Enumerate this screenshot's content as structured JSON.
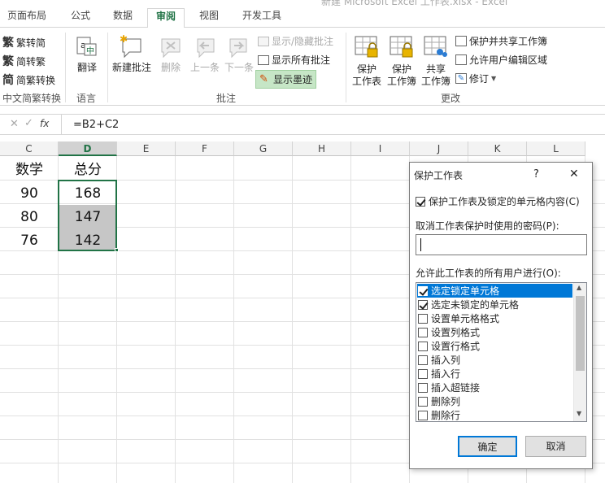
{
  "window_title": "新建 Microsoft Excel 工作表.xlsx - Excel",
  "tabs": [
    {
      "label": "页面布局"
    },
    {
      "label": "公式"
    },
    {
      "label": "数据"
    },
    {
      "label": "审阅",
      "active": true
    },
    {
      "label": "视图"
    },
    {
      "label": "开发工具"
    }
  ],
  "ribbon": {
    "group_chinese": {
      "label": "中文简繁转换",
      "items": [
        "繁转简",
        "简转繁",
        "简繁转换"
      ]
    },
    "group_language": {
      "label": "语言",
      "translate": "翻译"
    },
    "group_comments": {
      "label": "批注",
      "new_comment": "新建批注",
      "delete": "删除",
      "previous": "上一条",
      "next": "下一条",
      "show_hide": "显示/隐藏批注",
      "show_all": "显示所有批注",
      "show_ink": "显示墨迹"
    },
    "group_changes": {
      "label": "更改",
      "protect_sheet_1": "保护",
      "protect_sheet_2": "工作表",
      "protect_workbook_1": "保护",
      "protect_workbook_2": "工作簿",
      "share_workbook_1": "共享",
      "share_workbook_2": "工作簿",
      "protect_share": "保护并共享工作簿",
      "allow_edit": "允许用户编辑区域",
      "track_changes": "修订"
    }
  },
  "formula_bar": {
    "fx": "fx",
    "formula": "=B2+C2"
  },
  "columns": [
    "C",
    "D",
    "E",
    "F",
    "G",
    "H",
    "I",
    "J",
    "K",
    "L"
  ],
  "cells": {
    "c1": "数学",
    "d1": "总分",
    "c2": "90",
    "d2": "168",
    "c3": "80",
    "d3": "147",
    "c4": "76",
    "d4": "142"
  },
  "dialog": {
    "title": "保护工作表",
    "help": "?",
    "close": "✕",
    "protect_checkbox_label": "保护工作表及锁定的单元格内容(C)",
    "protect_checked": true,
    "password_label": "取消工作表保护时使用的密码(P):",
    "password_value": "",
    "allow_label": "允许此工作表的所有用户进行(O):",
    "options": [
      {
        "label": "选定锁定单元格",
        "checked": true,
        "selected": true
      },
      {
        "label": "选定未锁定的单元格",
        "checked": true
      },
      {
        "label": "设置单元格格式",
        "checked": false
      },
      {
        "label": "设置列格式",
        "checked": false
      },
      {
        "label": "设置行格式",
        "checked": false
      },
      {
        "label": "插入列",
        "checked": false
      },
      {
        "label": "插入行",
        "checked": false
      },
      {
        "label": "插入超链接",
        "checked": false
      },
      {
        "label": "删除列",
        "checked": false
      },
      {
        "label": "删除行",
        "checked": false
      }
    ],
    "ok": "确定",
    "cancel": "取消"
  },
  "colors": {
    "accent": "#217346",
    "selection": "#0078d7",
    "highlight": "#c6c6c6"
  }
}
